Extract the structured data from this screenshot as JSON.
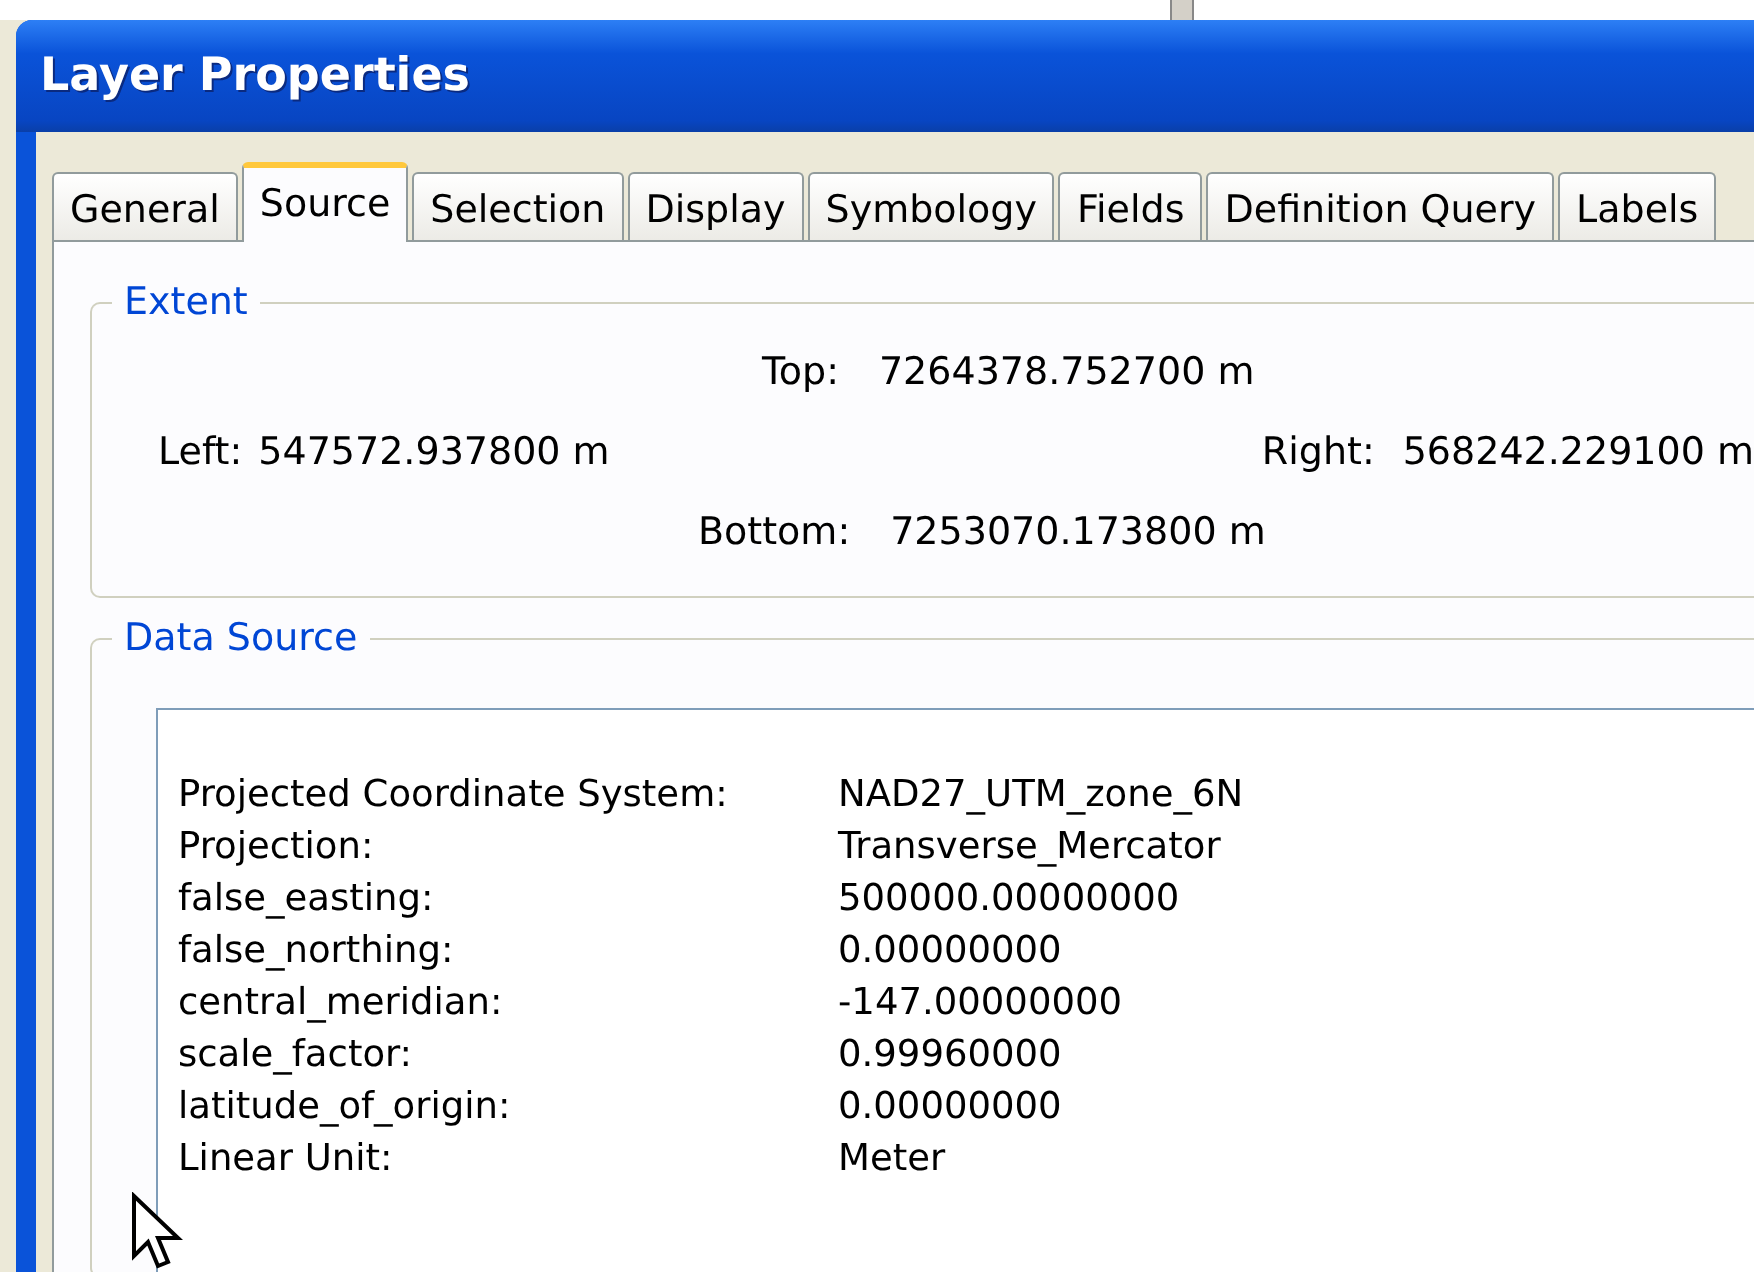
{
  "window": {
    "title": "Layer Properties"
  },
  "tabs": [
    {
      "label": "General",
      "selected": false
    },
    {
      "label": "Source",
      "selected": true
    },
    {
      "label": "Selection",
      "selected": false
    },
    {
      "label": "Display",
      "selected": false
    },
    {
      "label": "Symbology",
      "selected": false
    },
    {
      "label": "Fields",
      "selected": false
    },
    {
      "label": "Definition Query",
      "selected": false
    },
    {
      "label": "Labels",
      "selected": false
    }
  ],
  "extent": {
    "title": "Extent",
    "top": {
      "label": "Top:",
      "value": "7264378.752700 m"
    },
    "left": {
      "label": "Left:",
      "value": "547572.937800 m"
    },
    "right": {
      "label": "Right:",
      "value": "568242.229100 m"
    },
    "bottom": {
      "label": "Bottom:",
      "value": "7253070.173800 m"
    }
  },
  "data_source": {
    "title": "Data Source",
    "rows": [
      {
        "label": "Projected Coordinate System:",
        "value": "NAD27_UTM_zone_6N"
      },
      {
        "label": "Projection:",
        "value": "Transverse_Mercator"
      },
      {
        "label": "false_easting:",
        "value": "500000.00000000"
      },
      {
        "label": "false_northing:",
        "value": "0.00000000"
      },
      {
        "label": "central_meridian:",
        "value": "-147.00000000"
      },
      {
        "label": "scale_factor:",
        "value": "0.99960000"
      },
      {
        "label": "latitude_of_origin:",
        "value": "0.00000000"
      },
      {
        "label": "Linear Unit:",
        "value": "Meter"
      }
    ]
  }
}
